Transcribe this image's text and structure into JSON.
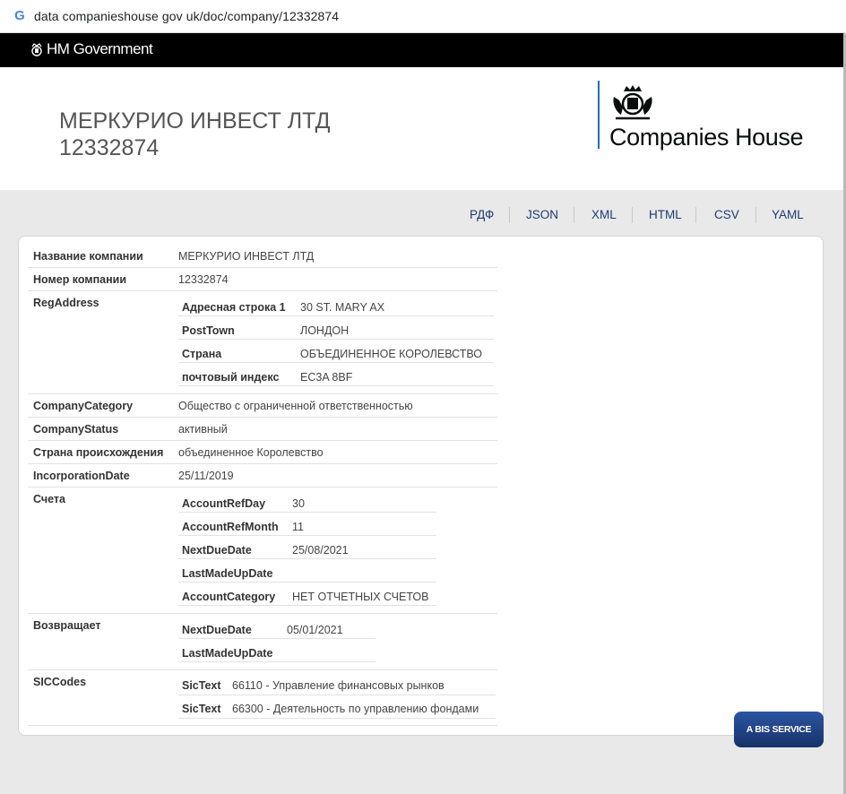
{
  "browser": {
    "url": "data companieshouse gov uk/doc/company/12332874",
    "favicon": "google-g-icon"
  },
  "govbar": {
    "label": "HM Government"
  },
  "header": {
    "company_name": "МЕРКУРИО ИНВЕСТ ЛТД",
    "company_number": "12332874",
    "brand": "Companies House"
  },
  "formats": [
    "РДФ",
    "JSON",
    "XML",
    "HTML",
    "CSV",
    "YAML"
  ],
  "details": {
    "name": {
      "label": "Название компании",
      "value": "МЕРКУРИО ИНВЕСТ ЛТД"
    },
    "number": {
      "label": "Номер компании",
      "value": "12332874"
    },
    "reg_address": {
      "label": "RegAddress",
      "fields": [
        {
          "label": "Адресная строка 1",
          "value": "30 ST. MARY AX"
        },
        {
          "label": "PostTown",
          "value": "ЛОНДОН"
        },
        {
          "label": "Страна",
          "value": "ОБЪЕДИНЕННОЕ КОРОЛЕВСТВО"
        },
        {
          "label": "почтовый индекс",
          "value": "EC3A 8BF"
        }
      ]
    },
    "category": {
      "label": "CompanyCategory",
      "value": "Общество с ограниченной ответственностью"
    },
    "status": {
      "label": "CompanyStatus",
      "value": "активный"
    },
    "origin": {
      "label": "Страна происхождения",
      "value": "объединенное Королевство"
    },
    "incorporation": {
      "label": "IncorporationDate",
      "value": "25/11/2019"
    },
    "accounts": {
      "label": "Счета",
      "fields": [
        {
          "label": "AccountRefDay",
          "value": "30"
        },
        {
          "label": "AccountRefMonth",
          "value": "11"
        },
        {
          "label": "NextDueDate",
          "value": "25/08/2021"
        },
        {
          "label": "LastMadeUpDate",
          "value": ""
        },
        {
          "label": "AccountCategory",
          "value": "НЕТ ОТЧЕТНЫХ СЧЕТОВ"
        }
      ]
    },
    "returns": {
      "label": "Возвращает",
      "fields": [
        {
          "label": "NextDueDate",
          "value": "05/01/2021"
        },
        {
          "label": "LastMadeUpDate",
          "value": ""
        }
      ]
    },
    "sic": {
      "label": "SICCodes",
      "fields": [
        {
          "label": "SicText",
          "value": "66110 - Управление финансовых рынков"
        },
        {
          "label": "SicText",
          "value": "66300 - Деятельность по управлению фондами"
        }
      ]
    }
  },
  "footer": {
    "bis_label": "A BIS SERVICE"
  }
}
